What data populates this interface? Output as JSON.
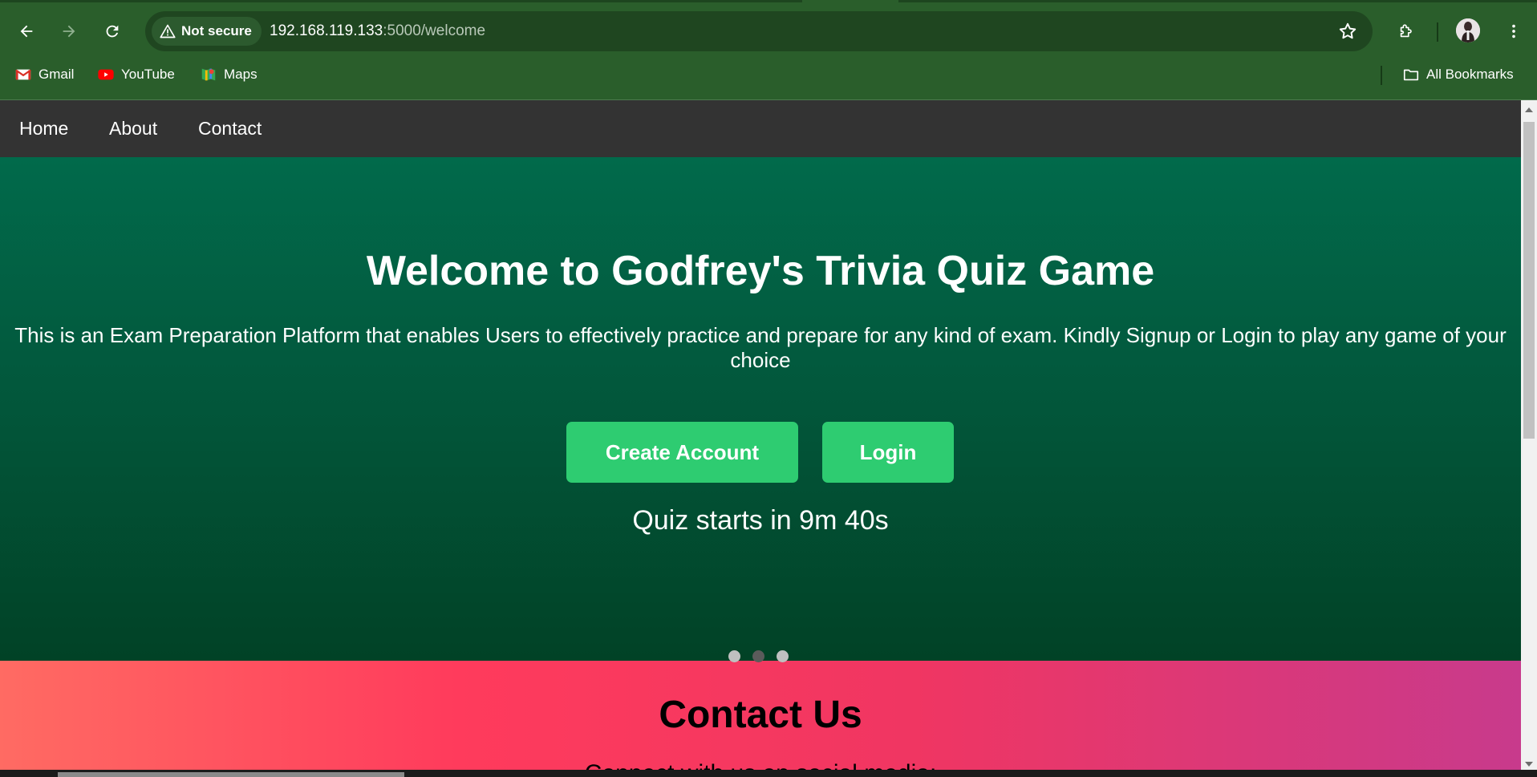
{
  "browser": {
    "security_label": "Not secure",
    "url_host": "192.168.119.133",
    "url_path": ":5000/welcome",
    "bookmarks": [
      {
        "label": "Gmail",
        "icon": "gmail-icon"
      },
      {
        "label": "YouTube",
        "icon": "youtube-icon"
      },
      {
        "label": "Maps",
        "icon": "maps-icon"
      }
    ],
    "all_bookmarks_label": "All Bookmarks"
  },
  "site_nav": {
    "items": [
      "Home",
      "About",
      "Contact"
    ]
  },
  "hero": {
    "title": "Welcome to Godfrey's Trivia Quiz Game",
    "description": "This is an Exam Preparation Platform that enables Users to effectively practice and prepare for any kind of exam. Kindly Signup or Login to play any game of your choice",
    "create_account_label": "Create Account",
    "login_label": "Login",
    "countdown": "Quiz starts in 9m 40s"
  },
  "contact": {
    "title": "Contact Us",
    "subtitle": "Connect with us on social media:"
  },
  "carousel": {
    "count": 3,
    "active_index": 1
  },
  "colors": {
    "chrome": "#2a5e2b",
    "site_nav": "#333333",
    "hero_top": "#016a4b",
    "hero_bottom": "#014226",
    "button": "#2ecc71",
    "contact_start": "#ff6b63",
    "contact_end": "#c83a8c"
  }
}
